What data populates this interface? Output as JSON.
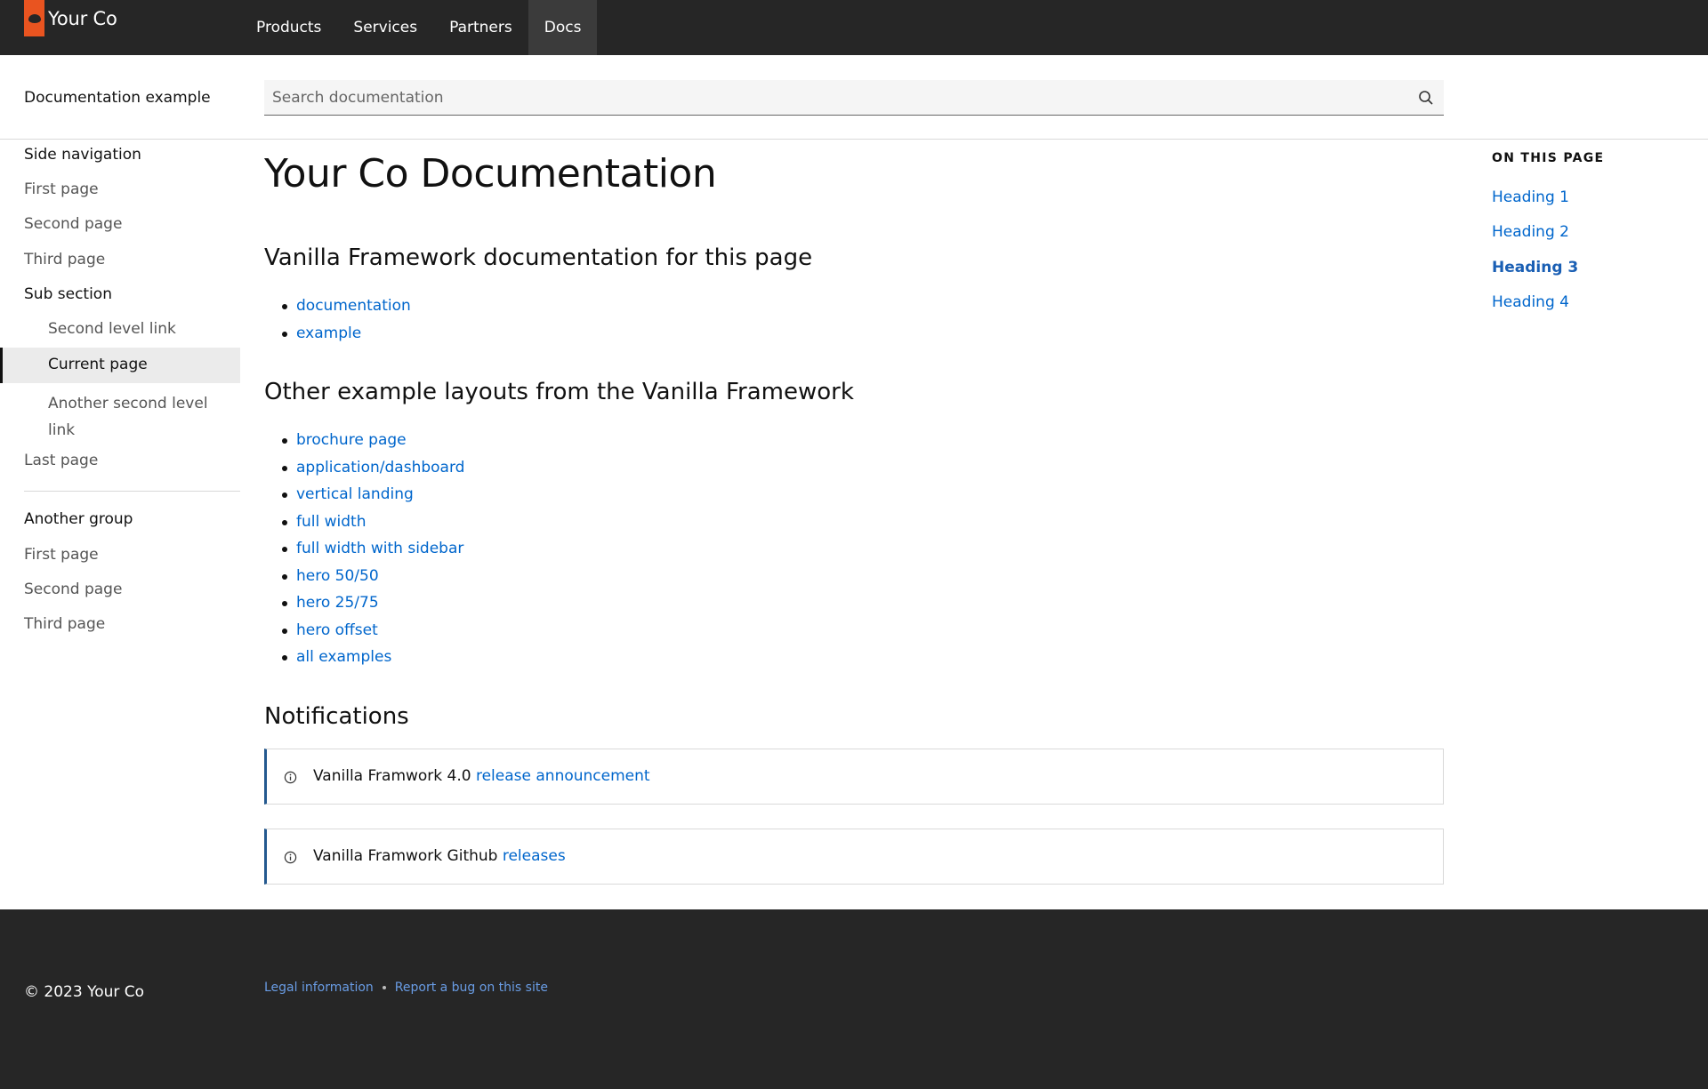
{
  "brand": {
    "name": "Your Co",
    "accent": "#e95420"
  },
  "topnav": {
    "items": [
      {
        "label": "Products"
      },
      {
        "label": "Services"
      },
      {
        "label": "Partners"
      },
      {
        "label": "Docs",
        "active": true
      }
    ]
  },
  "header": {
    "doc_title": "Documentation example",
    "search_placeholder": "Search documentation",
    "search_icon": "search-icon"
  },
  "sidebar": {
    "group1_heading": "Side navigation",
    "group1": [
      "First page",
      "Second page",
      "Third page"
    ],
    "sub_section": "Sub section",
    "sub_items": [
      "Second level link",
      "Current page",
      "Another second level link"
    ],
    "last_page": "Last page",
    "group2_heading": "Another group",
    "group2": [
      "First page",
      "Second page",
      "Third page"
    ]
  },
  "main": {
    "title": "Your Co Documentation",
    "section1_heading": "Vanilla Framework documentation for this page",
    "section1_links": [
      "documentation",
      "example"
    ],
    "section2_heading": "Other example layouts from the Vanilla Framework",
    "section2_links": [
      "brochure page",
      "application/dashboard",
      "vertical landing",
      "full width",
      "full width with sidebar",
      "hero 50/50",
      "hero 25/75",
      "hero offset",
      "all examples"
    ],
    "notifications_heading": "Notifications",
    "notifications": [
      {
        "text": "Vanilla Framwork 4.0 ",
        "link": "release announcement",
        "icon": "info-icon"
      },
      {
        "text": "Vanilla Framwork Github ",
        "link": "releases",
        "icon": "info-icon"
      }
    ]
  },
  "toc": {
    "title": "ON THIS PAGE",
    "items": [
      {
        "label": "Heading 1"
      },
      {
        "label": "Heading 2"
      },
      {
        "label": "Heading 3",
        "active": true
      },
      {
        "label": "Heading 4"
      }
    ]
  },
  "footer": {
    "copyright": "© 2023 Your Co",
    "links": [
      "Legal information",
      "Report a bug on this site"
    ]
  },
  "colors": {
    "link": "#0066cc",
    "dark": "#262626",
    "notice_border": "#24598f"
  }
}
